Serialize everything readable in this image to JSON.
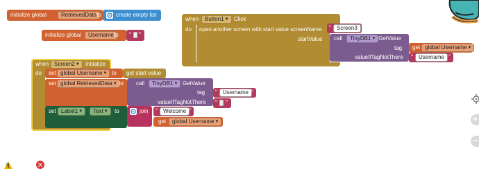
{
  "colors": {
    "variables": "#d1612f",
    "text": "#b33a5d",
    "control": "#b18c32",
    "tinydb": "#7c5b8f",
    "lists": "#3b8fd0",
    "components": "#2e6e3c"
  },
  "global_retrieved": {
    "prefix": "initialize global",
    "name": "RetrievedData",
    "to": "to",
    "list_icon": "gear-icon",
    "value": "create empty list"
  },
  "global_username": {
    "prefix": "initialize global",
    "name": "Username",
    "to": "to"
  },
  "button1": {
    "when": "when",
    "component": "Button1",
    "event": "Click",
    "do": "do",
    "call_text": "open another screen with start value  screenName",
    "screen_name": "Screen3",
    "start_value_label": "startValue",
    "call": "call",
    "tinydb": "TinyDB1",
    "method": "GetValue",
    "tag_label": "tag",
    "tag_get": "get",
    "tag_var": "global Username",
    "if_not_label": "valueIfTagNotThere",
    "if_not_value": "Username"
  },
  "screen2": {
    "when": "when",
    "component": "Screen2",
    "event": "Initialize",
    "do": "do",
    "set1": {
      "set": "set",
      "var": "global Username",
      "to": "to",
      "value": "get start value"
    },
    "set2": {
      "set": "set",
      "var": "global RetrievedData",
      "to": "to",
      "call": "call",
      "tinydb": "TinyDB1",
      "method": "GetValue",
      "tag_label": "tag",
      "tag_value": "Username",
      "if_not_label": "valueIfTagNotThere"
    },
    "set3": {
      "set": "set",
      "component": "Label1",
      "property": "Text",
      "to": "to",
      "join": "join",
      "join_text": "Welcome",
      "get": "get",
      "get_var": "global Username"
    }
  },
  "workspace": {
    "target_icon": "target-icon",
    "zoom_in": "+",
    "zoom_out": "−",
    "warnings_icon": "warning-icon",
    "warnings_count": "0",
    "errors_icon": "error-icon",
    "errors_count": "0"
  }
}
